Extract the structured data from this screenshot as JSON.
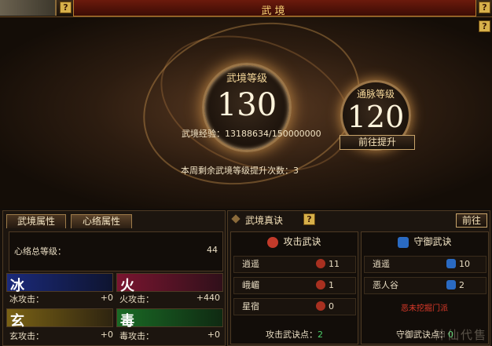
{
  "window": {
    "title": "武境",
    "help": "?"
  },
  "top": {
    "level_label": "武境等级",
    "level_value": "130",
    "vein_label": "通脉等级",
    "vein_value": "120",
    "exp_text": "武境经验：13188634/150000000",
    "goto_button": "前往提升",
    "weekly_text": "本周剩余武境等级提升次数：3"
  },
  "left": {
    "tabs": [
      {
        "label": "武境属性"
      },
      {
        "label": "心络属性"
      }
    ],
    "total": {
      "label": "心络总等级：",
      "value": "44"
    },
    "elements": [
      {
        "char": "冰",
        "attack_label": "冰攻击：",
        "value": "+0",
        "color": "#1b2a7a"
      },
      {
        "char": "火",
        "attack_label": "火攻击：",
        "value": "+440",
        "color": "#7a1530"
      },
      {
        "char": "玄",
        "attack_label": "玄攻击：",
        "value": "+0",
        "color": "#7a6215"
      },
      {
        "char": "毒",
        "attack_label": "毒攻击：",
        "value": "+0",
        "color": "#1a6a25"
      }
    ]
  },
  "right": {
    "title": "武境真诀",
    "goto_button": "前往",
    "attack": {
      "title": "攻击武诀",
      "skills": [
        {
          "name": "逍遥",
          "value": "11"
        },
        {
          "name": "峨嵋",
          "value": "1"
        },
        {
          "name": "星宿",
          "value": "0"
        }
      ],
      "points_label": "攻击武诀点：",
      "points_value": "2"
    },
    "defense": {
      "title": "守御武诀",
      "skills": [
        {
          "name": "逍遥",
          "value": "10"
        },
        {
          "name": "恶人谷",
          "value": "2"
        }
      ],
      "red_text": "恶未挖掘门派",
      "points_label": "守御武诀点：",
      "points_value": "0"
    }
  },
  "watermark": "神仙代售"
}
